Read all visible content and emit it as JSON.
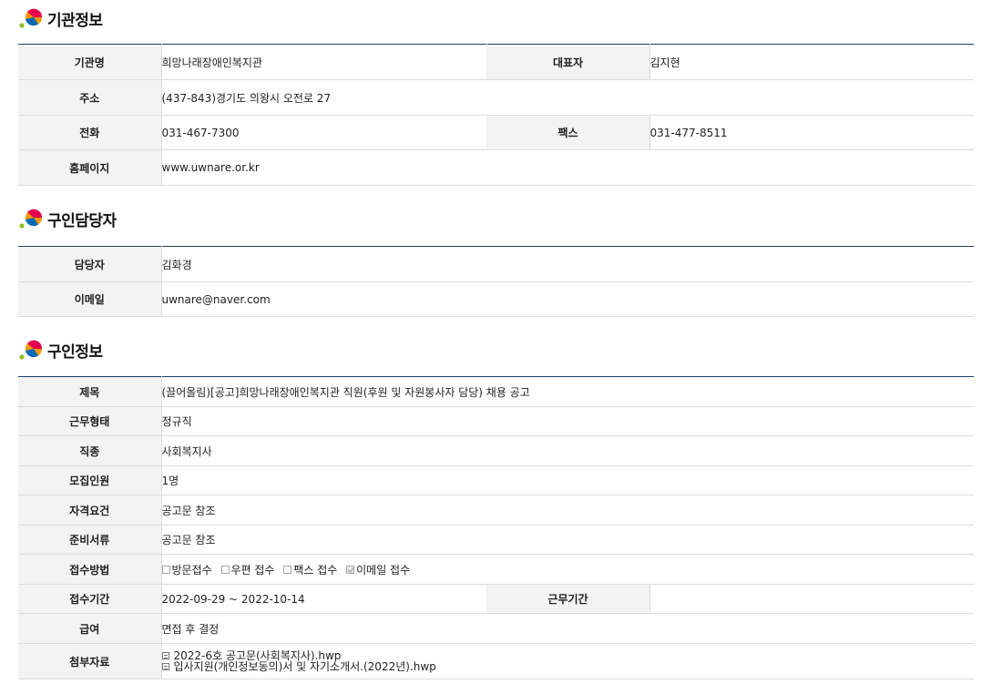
{
  "org": {
    "title": "기관정보",
    "name_label": "기관명",
    "name": "희망나래장애인복지관",
    "ceo_label": "대표자",
    "ceo": "김지현",
    "address_label": "주소",
    "address": "(437-843)경기도 의왕시 오전로 27",
    "phone_label": "전화",
    "phone": "031-467-7300",
    "fax_label": "팩스",
    "fax": "031-477-8511",
    "homepage_label": "홈페이지",
    "homepage": "www.uwnare.or.kr"
  },
  "contact": {
    "title": "구인담당자",
    "manager_label": "담당자",
    "manager": "김화경",
    "email_label": "이메일",
    "email": "uwnare@naver.com"
  },
  "job": {
    "title": "구인정보",
    "subject_label": "제목",
    "subject": "(끌어올림)[공고]희망나래장애인복지관 직원(후원 및 자원봉사자 담당) 채용 공고",
    "employment_label": "근무형태",
    "employment": "정규직",
    "occupation_label": "직종",
    "occupation": "사회복지사",
    "headcount_label": "모집인원",
    "headcount": "1명",
    "qualification_label": "자격요건",
    "qualification": "공고문 참조",
    "documents_label": "준비서류",
    "documents": "공고문 참조",
    "method_label": "접수방법",
    "methods": [
      {
        "label": "방문접수",
        "checked": false
      },
      {
        "label": "우편 접수",
        "checked": false
      },
      {
        "label": "팩스 접수",
        "checked": false
      },
      {
        "label": "이메일 접수",
        "checked": true
      }
    ],
    "period_label": "접수기간",
    "period": "2022-09-29 ~ 2022-10-14",
    "work_period_label": "근무기간",
    "work_period": "",
    "salary_label": "급여",
    "salary": "면접 후 결정",
    "attachments_label": "첨부자료",
    "attachments": [
      "2022-6호 공고문(사회복지사).hwp",
      "입사지원(개인정보동의)서 및 자기소개서.(2022년).hwp"
    ]
  },
  "colors": {
    "accent_line": "#1f3f66",
    "header_bg": "#f3f3f3"
  },
  "icons": {
    "section": "logo-icon",
    "checkbox": "checkbox-icon",
    "attachment": "file-icon"
  }
}
